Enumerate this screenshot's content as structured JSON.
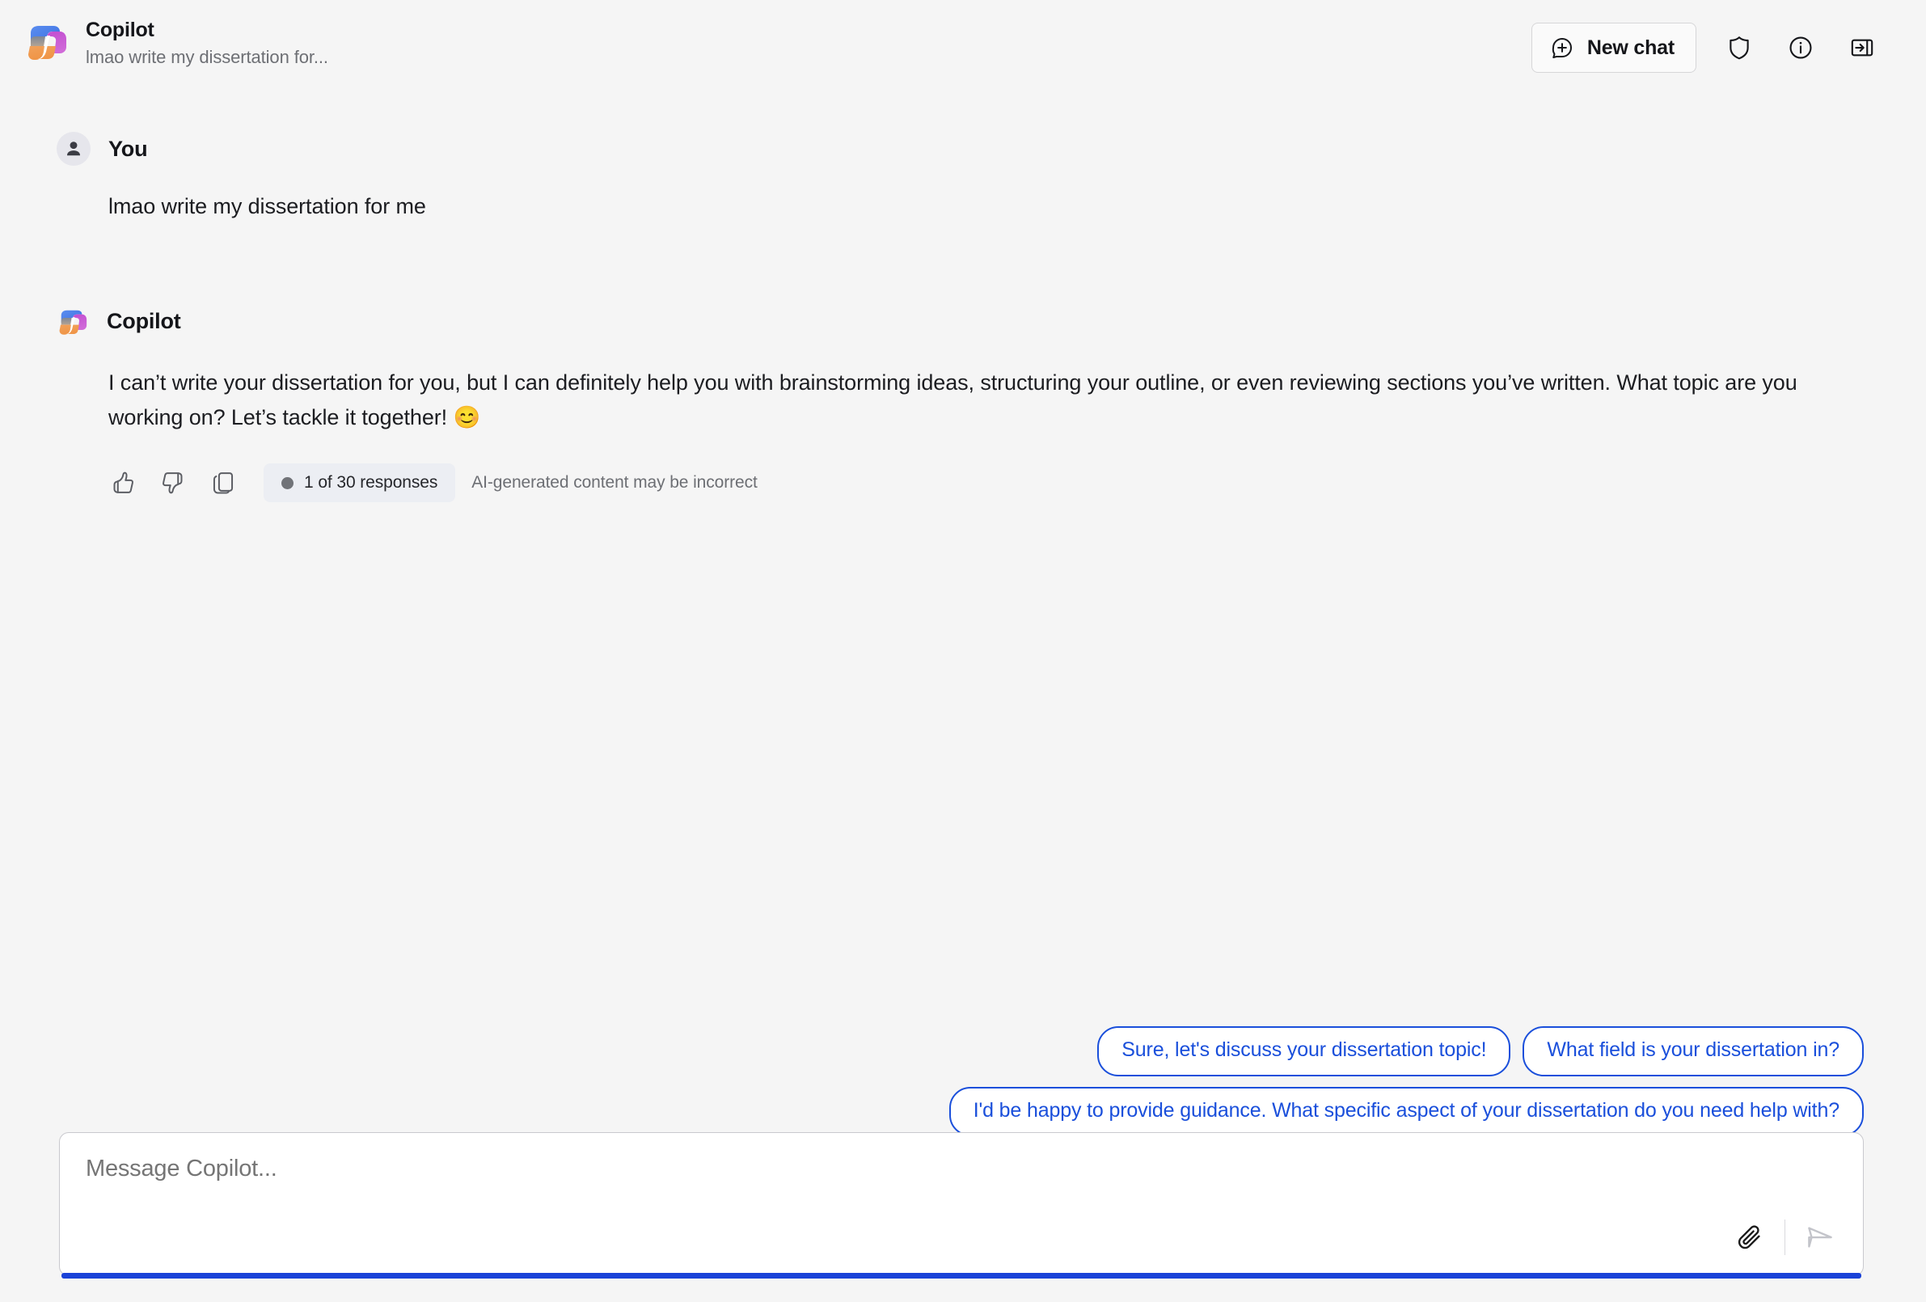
{
  "theme": {
    "page_background": "#f5f5f5",
    "accent_blue": "#1a4fdb",
    "focus_line_blue": "#1a42d8",
    "badge_background": "#eceef3",
    "muted_text": "#6d6f74"
  },
  "header": {
    "logo_icon": "copilot-logo-icon",
    "title": "Copilot",
    "subtitle": "lmao write my dissertation for...",
    "new_chat": {
      "label": "New chat",
      "icon": "chat-bubble-plus-icon"
    },
    "actions": [
      {
        "icon": "shield-icon",
        "name": "privacy-shield-button"
      },
      {
        "icon": "info-circle-icon",
        "name": "info-button"
      },
      {
        "icon": "panel-collapse-icon",
        "name": "collapse-panel-button"
      }
    ]
  },
  "conversation": {
    "user_message": {
      "author": "You",
      "avatar_icon": "person-avatar-icon",
      "text": "lmao write my dissertation for me"
    },
    "bot_message": {
      "author": "Copilot",
      "avatar_icon": "copilot-logo-icon",
      "text": "I can’t write your dissertation for you, but I can definitely help you with brainstorming ideas, structuring your outline, or even reviewing sections you’ve written. What topic are you working on? Let’s tackle it together! 😊",
      "actions": {
        "thumbs_up_icon": "thumbs-up-icon",
        "thumbs_down_icon": "thumbs-down-icon",
        "copy_icon": "copy-icon",
        "response_counter": "1 of 30 responses",
        "disclaimer": "AI-generated content may be incorrect"
      }
    }
  },
  "suggestions": {
    "row_one": [
      "Sure, let's discuss your dissertation topic!",
      "What field is your dissertation in?"
    ],
    "row_two": [
      "I'd be happy to provide guidance. What specific aspect of your dissertation do you need help with?"
    ]
  },
  "composer": {
    "placeholder": "Message Copilot...",
    "value": "",
    "attach_icon": "paperclip-icon",
    "send_icon": "send-arrow-icon"
  }
}
